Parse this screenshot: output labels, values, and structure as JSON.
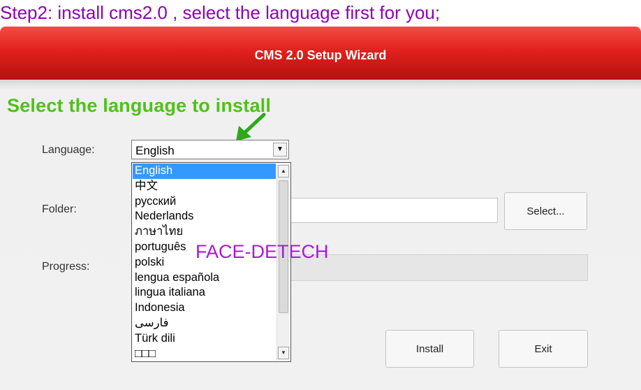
{
  "caption": "Step2: install cms2.0 , select the language first for you;",
  "window": {
    "title": "CMS 2.0 Setup Wizard",
    "heading": "Select the language to install"
  },
  "form": {
    "language_label": "Language:",
    "language_value": "English",
    "folder_label": "Folder:",
    "folder_value": "",
    "progress_label": "Progress:",
    "progress_value": 0,
    "select_button": "Select...",
    "install_button": "Install",
    "exit_button": "Exit"
  },
  "dropdown": {
    "selected": "English",
    "options": [
      "English",
      "中文",
      "русский",
      "Nederlands",
      "ภาษาไทย",
      "português",
      "polski",
      "lengua española",
      "lingua italiana",
      "Indonesia",
      "فارسی",
      "Türk dili",
      "□□□"
    ]
  },
  "watermark": "FACE-DETECH",
  "icons": {
    "dropdown_arrow": "chevron-down-icon",
    "scroll_up": "scroll-up-icon",
    "scroll_down": "scroll-down-icon",
    "pointer": "green-arrow-icon"
  },
  "colors": {
    "titlebar": "#e1211d",
    "heading": "#4ec21a",
    "caption": "#8f00b8",
    "watermark": "#a818d8",
    "selection": "#3399ff"
  }
}
